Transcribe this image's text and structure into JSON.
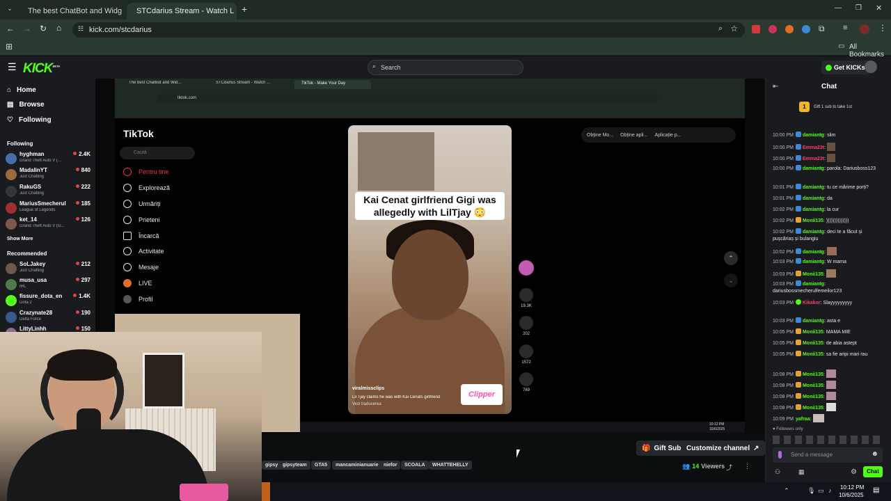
{
  "browser": {
    "tabs": [
      {
        "title": "The best ChatBot and Widg",
        "active": false
      },
      {
        "title": "STCdarius Stream - Watch L",
        "active": true
      }
    ],
    "url": "kick.com/stcdarius",
    "bookmarks_label": "All Bookmarks"
  },
  "kick": {
    "logo": "KICK",
    "logo_beta": "BETA",
    "search_placeholder": "Search",
    "get_kicks": "Get KICKs",
    "nav": [
      "Home",
      "Browse",
      "Following"
    ],
    "following_header": "Following",
    "following": [
      {
        "name": "hyghman",
        "game": "Grand Theft Auto V (...",
        "viewers": "2.4K",
        "color": "#4a6fa8"
      },
      {
        "name": "MadalinYT",
        "game": "Just Chatting",
        "viewers": "840",
        "color": "#9b6b3a"
      },
      {
        "name": "RakuGS",
        "game": "Just Chatting",
        "viewers": "222",
        "color": "#33363b"
      },
      {
        "name": "MariusSmecherul",
        "game": "League of Legends",
        "viewers": "185",
        "color": "#a12f2f"
      },
      {
        "name": "ket_14",
        "game": "Grand Theft Auto V (G...",
        "viewers": "126",
        "color": "#7a5a4a"
      }
    ],
    "show_more": "Show More",
    "recommended_header": "Recommended",
    "recommended": [
      {
        "name": "SoLJakey",
        "game": "Just Chatting",
        "viewers": "212",
        "color": "#6a5a4a"
      },
      {
        "name": "musa_usa",
        "game": "IRL",
        "viewers": "297",
        "color": "#4f7a4f"
      },
      {
        "name": "fissure_dota_en",
        "game": "Dota 2",
        "viewers": "1.4K",
        "color": "#53fc18"
      },
      {
        "name": "Crazynate28",
        "game": "Delta Force",
        "viewers": "190",
        "color": "#3a5a8a"
      },
      {
        "name": "LittyLinhh",
        "game": "",
        "viewers": "150",
        "color": "#8a6a8a"
      }
    ],
    "gift_subs": "Gift Subs",
    "customize": "Customize channel",
    "tags": [
      "gipsy",
      "gipsyteam",
      "GTA5",
      "mancaminianuarie",
      "niefor",
      "SCOALA",
      "WHATTEHELLY"
    ],
    "viewers_count": "14",
    "viewers_label": "Viewers"
  },
  "stream": {
    "inner_tabs": [
      "The best ChatBot and Wid...",
      "STCdarius Stream - Watch ...",
      "TikTok - Make Your Day"
    ],
    "inner_url": "tiktok.com",
    "tiktok_logo": "TikTok",
    "tiktok_search": "Caută",
    "tiktok_nav": [
      "Pentru tine",
      "Explorează",
      "Urmăriți",
      "Prieteni",
      "Încarcă",
      "Activitate",
      "Mesaje",
      "LIVE",
      "Profil"
    ],
    "tiktok_top": [
      "Obține Mo...",
      "Obține apli...",
      "Aplicație p..."
    ],
    "video_caption": "Kai Cenat girlfriend Gigi was allegedly with LilTjay 😳",
    "video_author": "viralmissclips",
    "video_desc": "Lil Tjay claims he was with Kai Cenats girlfriend",
    "video_translate": "Vezi traducerea",
    "clipper": "Clipper",
    "actions": [
      {
        "name": "likes",
        "count": "19.3K"
      },
      {
        "name": "comments",
        "count": "202"
      },
      {
        "name": "saves",
        "count": "1572"
      },
      {
        "name": "shares",
        "count": "769"
      }
    ],
    "taskbar_time": "10:12 PM",
    "taskbar_date": "10/6/2025"
  },
  "chat": {
    "title": "Chat",
    "gift_banner": "Gift 1 sub to take 1st",
    "gift_rank": "1",
    "messages": [
      {
        "time": "10:00 PM",
        "user": "damiantg",
        "text": "slim",
        "color": "#53fc18"
      },
      {
        "time": "10:00 PM",
        "user": "Emma23t",
        "text": "",
        "color": "#ff3d6e"
      },
      {
        "time": "10:00 PM",
        "user": "Emma23t",
        "text": "",
        "color": "#ff3d6e"
      },
      {
        "time": "10:00 PM",
        "user": "damiantg",
        "text": "parola: Dariusboss123",
        "color": "#53fc18"
      },
      {
        "time": "10:01 PM",
        "user": "damiantg",
        "text": "tu ce mărime porți?",
        "color": "#53fc18"
      },
      {
        "time": "10:01 PM",
        "user": "damiantg",
        "text": "da",
        "color": "#53fc18"
      },
      {
        "time": "10:02 PM",
        "user": "damiantg",
        "text": "la cur",
        "color": "#53fc18"
      },
      {
        "time": "10:02 PM",
        "user": "Monii135",
        "text": "))))))))))))))",
        "color": "#53fc18"
      },
      {
        "time": "10:02 PM",
        "user": "damiantg",
        "text": "deci te a făcut și pușcăriaș și bulangiu",
        "color": "#53fc18"
      },
      {
        "time": "10:02 PM",
        "user": "damiantg",
        "text": "",
        "color": "#53fc18"
      },
      {
        "time": "10:03 PM",
        "user": "damiantg",
        "text": "W mama",
        "color": "#53fc18"
      },
      {
        "time": "10:03 PM",
        "user": "Monii135",
        "text": "",
        "color": "#53fc18"
      },
      {
        "time": "10:03 PM",
        "user": "damiantg",
        "text": "dariusbossmecherulfemeilor123",
        "color": "#53fc18"
      },
      {
        "time": "10:03 PM",
        "user": "Kikakor",
        "text": "Slayyyyyyyyy",
        "color": "#ff3d6e"
      },
      {
        "time": "10:03 PM",
        "user": "damiantg",
        "text": "asta e",
        "color": "#53fc18"
      },
      {
        "time": "10:05 PM",
        "user": "Monii135",
        "text": "MAMA MIE",
        "color": "#53fc18"
      },
      {
        "time": "10:05 PM",
        "user": "Monii135",
        "text": "de abia astept",
        "color": "#53fc18"
      },
      {
        "time": "10:05 PM",
        "user": "Monii135",
        "text": "sa fie aripi mari rau",
        "color": "#53fc18"
      },
      {
        "time": "10:08 PM",
        "user": "Monii135",
        "text": "",
        "color": "#53fc18"
      },
      {
        "time": "10:08 PM",
        "user": "Monii135",
        "text": "",
        "color": "#53fc18"
      },
      {
        "time": "10:08 PM",
        "user": "Monii135",
        "text": "",
        "color": "#53fc18"
      },
      {
        "time": "10:08 PM",
        "user": "Monii135",
        "text": "",
        "color": "#53fc18"
      },
      {
        "time": "10:09 PM",
        "user": "yafraa",
        "text": "",
        "color": "#53fc18"
      }
    ],
    "followers_only": "Followers only",
    "input_placeholder": "Send a message",
    "send_label": "Chat"
  }
}
